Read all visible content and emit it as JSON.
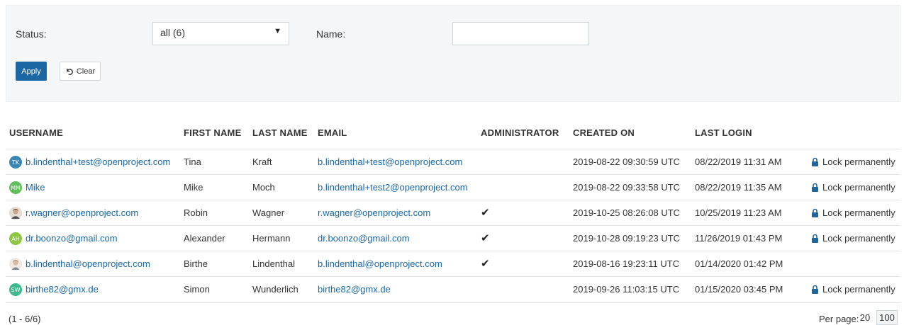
{
  "filters": {
    "status_label": "Status:",
    "status_value": "all (6)",
    "name_label": "Name:",
    "name_value": "",
    "apply_label": "Apply",
    "clear_label": "Clear"
  },
  "table": {
    "columns": [
      "USERNAME",
      "FIRST NAME",
      "LAST NAME",
      "EMAIL",
      "ADMINISTRATOR",
      "CREATED ON",
      "LAST LOGIN"
    ],
    "rows": [
      {
        "avatar_initials": "TK",
        "avatar_color": "#3a86b5",
        "username": "b.lindenthal+test@openproject.com",
        "first_name": "Tina",
        "last_name": "Kraft",
        "email": "b.lindenthal+test@openproject.com",
        "admin": false,
        "created_on": "2019-08-22 09:30:59 UTC",
        "last_login": "08/22/2019 11:31 AM",
        "action": "Lock permanently"
      },
      {
        "avatar_initials": "MM",
        "avatar_color": "#5fbf5a",
        "username": "Mike",
        "first_name": "Mike",
        "last_name": "Moch",
        "email": "b.lindenthal+test2@openproject.com",
        "admin": false,
        "created_on": "2019-08-22 09:33:58 UTC",
        "last_login": "08/22/2019 11:35 AM",
        "action": "Lock permanently"
      },
      {
        "avatar_initials": "",
        "avatar_color": "#c9a68c",
        "username": "r.wagner@openproject.com",
        "first_name": "Robin",
        "last_name": "Wagner",
        "email": "r.wagner@openproject.com",
        "admin": true,
        "created_on": "2019-10-25 08:26:08 UTC",
        "last_login": "10/25/2019 11:23 AM",
        "action": "Lock permanently"
      },
      {
        "avatar_initials": "AH",
        "avatar_color": "#8cc63f",
        "username": "dr.boonzo@gmail.com",
        "first_name": "Alexander",
        "last_name": "Hermann",
        "email": "dr.boonzo@gmail.com",
        "admin": true,
        "created_on": "2019-10-28 09:19:23 UTC",
        "last_login": "11/26/2019 01:43 PM",
        "action": "Lock permanently"
      },
      {
        "avatar_initials": "",
        "avatar_color": "#d8b9a2",
        "username": "b.lindenthal@openproject.com",
        "first_name": "Birthe",
        "last_name": "Lindenthal",
        "email": "b.lindenthal@openproject.com",
        "admin": true,
        "created_on": "2019-08-16 19:23:11 UTC",
        "last_login": "01/14/2020 01:42 PM",
        "action": ""
      },
      {
        "avatar_initials": "SW",
        "avatar_color": "#3dbb8a",
        "username": "birthe82@gmx.de",
        "first_name": "Simon",
        "last_name": "Wunderlich",
        "email": "birthe82@gmx.de",
        "admin": false,
        "created_on": "2019-09-26 11:03:15 UTC",
        "last_login": "01/15/2020 03:45 PM",
        "action": "Lock permanently"
      }
    ]
  },
  "footer": {
    "range": "(1 - 6/6)",
    "per_page_label": "Per page:",
    "per_page_options": [
      "20",
      "100"
    ],
    "per_page_selected": "100"
  }
}
